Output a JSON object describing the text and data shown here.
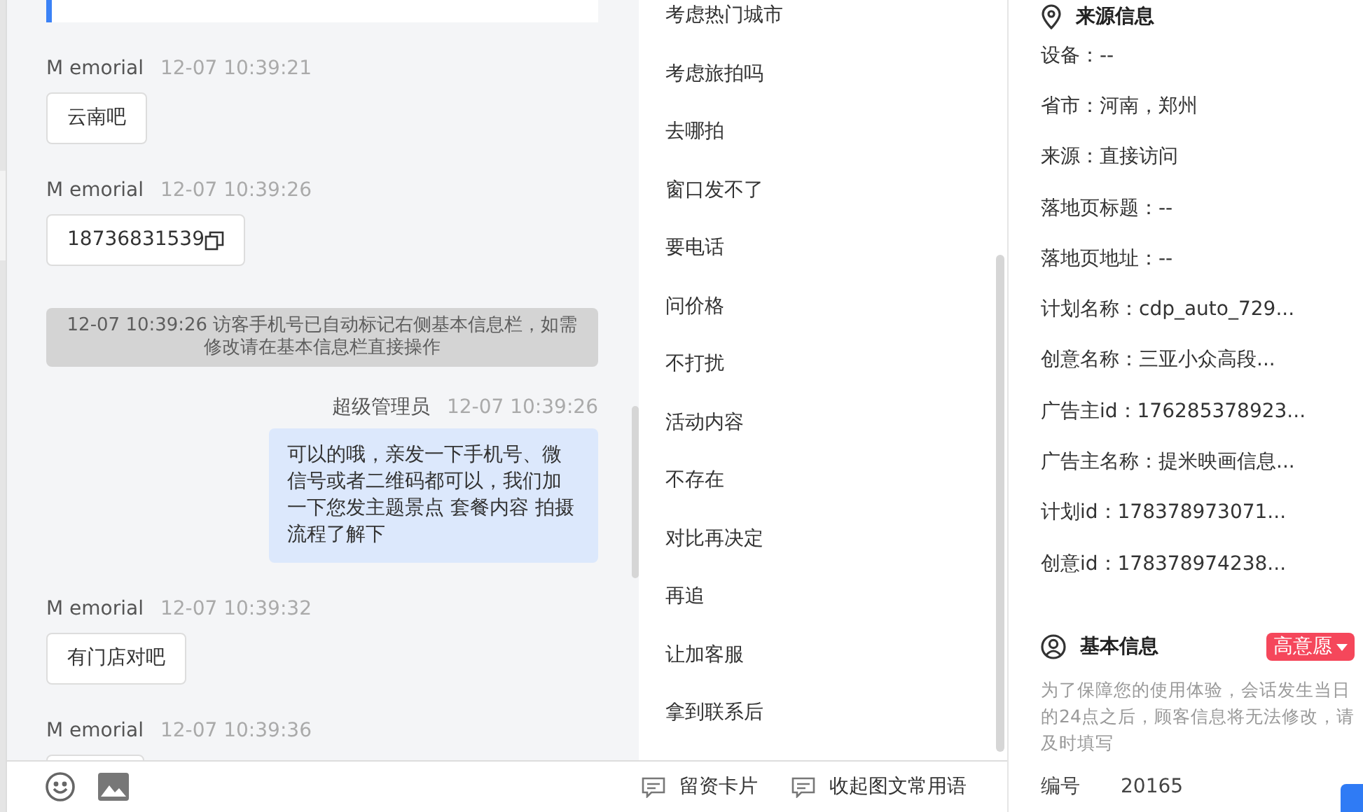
{
  "chat": {
    "messages": [
      {
        "kind": "card"
      },
      {
        "kind": "incoming",
        "sender": "M emorial",
        "time": "12-07 10:39:21",
        "text": "云南吧",
        "copyable": false
      },
      {
        "kind": "incoming",
        "sender": "M emorial",
        "time": "12-07 10:39:26",
        "text": "18736831539",
        "copyable": true
      },
      {
        "kind": "system",
        "text": "12-07 10:39:26 访客手机号已自动标记右侧基本信息栏，如需修改请在基本信息栏直接操作"
      },
      {
        "kind": "outgoing",
        "sender": "超级管理员",
        "time": "12-07 10:39:26",
        "text": "可以的哦，亲发一下手机号、微信号或者二维码都可以，我们加一下您发主题景点 套餐内容 拍摄流程了解下"
      },
      {
        "kind": "incoming",
        "sender": "M emorial",
        "time": "12-07 10:39:32",
        "text": "有门店对吧",
        "copyable": false
      },
      {
        "kind": "incoming",
        "sender": "M emorial",
        "time": "12-07 10:39:36"
      }
    ]
  },
  "quick_replies": {
    "items": [
      "考虑热门城市",
      "考虑旅拍吗",
      "去哪拍",
      "窗口发不了",
      "要电话",
      "问价格",
      "不打扰",
      "活动内容",
      "不存在",
      "对比再决定",
      "再追",
      "让加客服",
      "拿到联系后"
    ],
    "footer": [
      {
        "label": "留资卡片"
      },
      {
        "label": "收起图文常用语"
      }
    ]
  },
  "source_info": {
    "title": "来源信息",
    "rows": [
      "设备：--",
      "省市：河南，郑州",
      "来源：直接访问",
      "落地页标题：--",
      "落地页地址：--",
      "计划名称：cdp_auto_729...",
      "创意名称：三亚小众高段...",
      "广告主id：176285378923...",
      "广告主名称：提米映画信息...",
      "计划id：178378973071...",
      "创意id：178378974238..."
    ]
  },
  "basic_info": {
    "title": "基本信息",
    "intent": {
      "label": "高意愿",
      "color": "#f5475b"
    },
    "notice": "为了保障您的使用体验，会话发生当日的24点之后，顾客信息将无法修改，请及时填写",
    "fields": [
      {
        "label": "编号",
        "value": "20165"
      }
    ]
  }
}
